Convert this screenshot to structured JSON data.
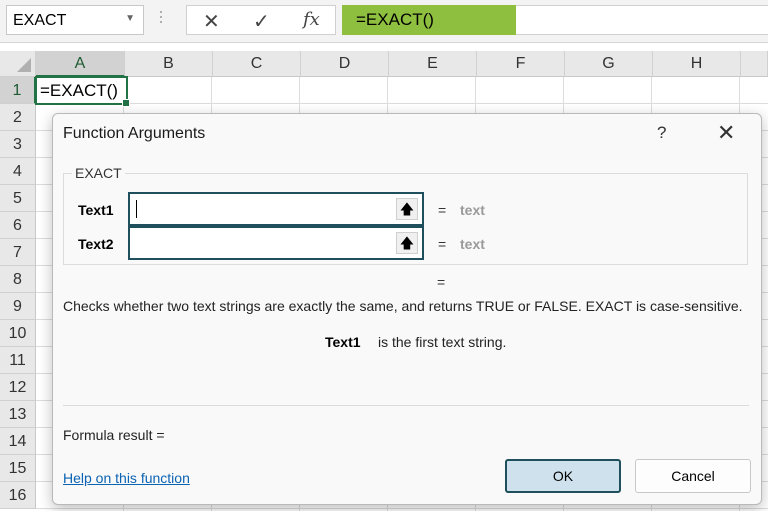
{
  "formula_bar": {
    "name_box": "EXACT",
    "cancel_glyph": "✕",
    "enter_glyph": "✓",
    "fx_glyph": "fx",
    "formula": "=EXACT()"
  },
  "grid": {
    "columns": [
      "A",
      "B",
      "C",
      "D",
      "E",
      "F",
      "G",
      "H"
    ],
    "rows": [
      "1",
      "2",
      "3",
      "4",
      "5",
      "6",
      "7",
      "8",
      "9",
      "10",
      "11",
      "12",
      "13",
      "14",
      "15",
      "16"
    ],
    "active_cell_text": "=EXACT()"
  },
  "dialog": {
    "title": "Function Arguments",
    "help_glyph": "?",
    "close_glyph": "✕",
    "function_name": "EXACT",
    "args": [
      {
        "name": "Text1",
        "value": "",
        "eq": "=",
        "type": "text"
      },
      {
        "name": "Text2",
        "value": "",
        "eq": "=",
        "type": "text"
      }
    ],
    "result_eq": "=",
    "description": "Checks whether two text strings are exactly the same, and returns TRUE or FALSE. EXACT is case-sensitive.",
    "arg_desc_name": "Text1",
    "arg_desc_text": "is the first text string.",
    "formula_result": "Formula result =",
    "help_link": "Help on this function",
    "ok": "OK",
    "cancel": "Cancel"
  },
  "colors": {
    "accent": "#217346",
    "formula_highlight": "#8fbf3f",
    "dialog_border": "#1f4f5c",
    "link": "#0b63b3"
  }
}
